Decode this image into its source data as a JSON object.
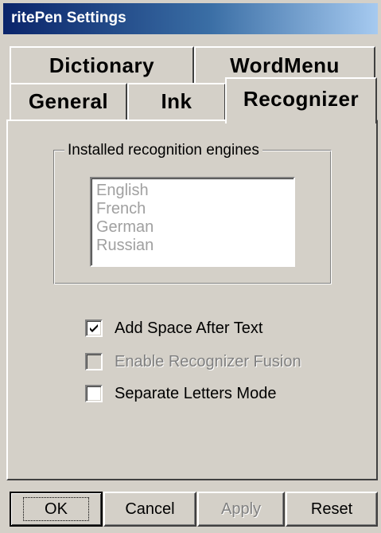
{
  "window": {
    "title": "ritePen Settings"
  },
  "tabs": {
    "dictionary": "Dictionary",
    "wordmenu": "WordMenu",
    "general": "General",
    "ink": "Ink",
    "recognizer": "Recognizer",
    "active": "Recognizer"
  },
  "recognizer": {
    "group_label": "Installed recognition engines",
    "engines": [
      "English",
      "French",
      "German",
      "Russian"
    ],
    "options": [
      {
        "label": "Add Space  After Text",
        "checked": true,
        "enabled": true
      },
      {
        "label": "Enable Recognizer Fusion",
        "checked": false,
        "enabled": false
      },
      {
        "label": "Separate Letters Mode",
        "checked": false,
        "enabled": true
      }
    ]
  },
  "buttons": {
    "ok": "OK",
    "cancel": "Cancel",
    "apply": "Apply",
    "reset": "Reset"
  },
  "colors": {
    "face": "#d4d0c8",
    "title_start": "#0a246a",
    "title_end": "#a6caf0",
    "disabled_text": "#808080"
  }
}
